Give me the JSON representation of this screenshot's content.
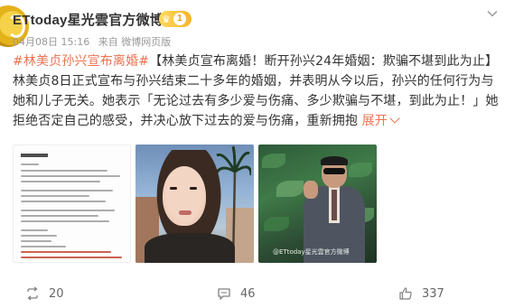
{
  "header": {
    "username": "ETtoday星光雲官方微博",
    "vip_level": "1",
    "date": "04月08日 15:16",
    "source": "来自 微博网页版"
  },
  "post": {
    "hashtag": "#林美贞孙兴宣布离婚#",
    "text": "【林美贞宣布离婚！断开孙兴24年婚姻：欺骗不堪到此为止】林美贞8日正式宣布与孙兴结束二十多年的婚姻，并表明从今以后，孙兴的任何行为与她和儿子无关。她表示「无论过去有多少爱与伤痛、多少欺骗与不堪，到此为止！」她拒绝否定自己的感受，并决心放下过去的爱与伤痛，重新拥抱",
    "more_label": "展开"
  },
  "images": {
    "watermark": "@ETtoday星光雲官方微博"
  },
  "actions": {
    "repost_count": "20",
    "comment_count": "46",
    "like_count": "337"
  },
  "colors": {
    "accent": "#eb7350",
    "meta": "#999999",
    "vip_gold": "#f7b52c"
  },
  "icons": {
    "repost": "repost-icon",
    "comment": "comment-icon",
    "like": "thumbs-up-icon",
    "menu": "chevron-down-icon"
  }
}
